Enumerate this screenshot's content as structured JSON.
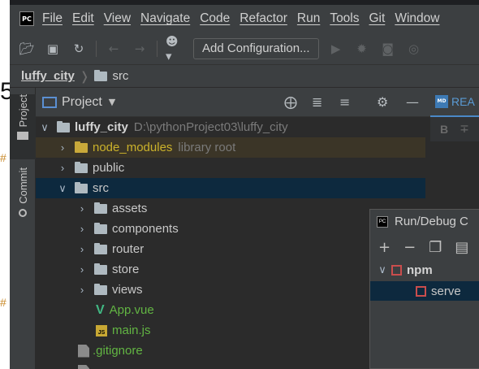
{
  "menu": {
    "items": [
      "File",
      "Edit",
      "View",
      "Navigate",
      "Code",
      "Refactor",
      "Run",
      "Tools",
      "Git",
      "Window"
    ]
  },
  "toolbar": {
    "add_configuration_label": "Add Configuration..."
  },
  "breadcrumb": {
    "project": "luffy_city",
    "folder": "src"
  },
  "side_tabs": {
    "project": "Project",
    "commit": "Commit"
  },
  "panel": {
    "title": "Project"
  },
  "tree": {
    "root": {
      "name": "luffy_city",
      "path": "D:\\pythonProject03\\luffy_city"
    },
    "node_modules": {
      "name": "node_modules",
      "note": "library root"
    },
    "public": "public",
    "src": "src",
    "children": [
      "assets",
      "components",
      "router",
      "store",
      "views"
    ],
    "app_vue": "App.vue",
    "main_js": "main.js",
    "gitignore": ".gitignore"
  },
  "editor": {
    "tab_label": "REA",
    "bold_label": "B"
  },
  "run_debug": {
    "title": "Run/Debug C",
    "npm_label": "npm",
    "serve_label": "serve"
  },
  "left_strip": {
    "glyph_top": "5",
    "glyph_mid": "#",
    "glyph_low": "#"
  },
  "colors": {
    "background": "#2b2b2b",
    "chrome": "#3c3f41",
    "selection": "#0d293e",
    "vcs_new": "#62b543",
    "excluded": "#cbb22b"
  }
}
